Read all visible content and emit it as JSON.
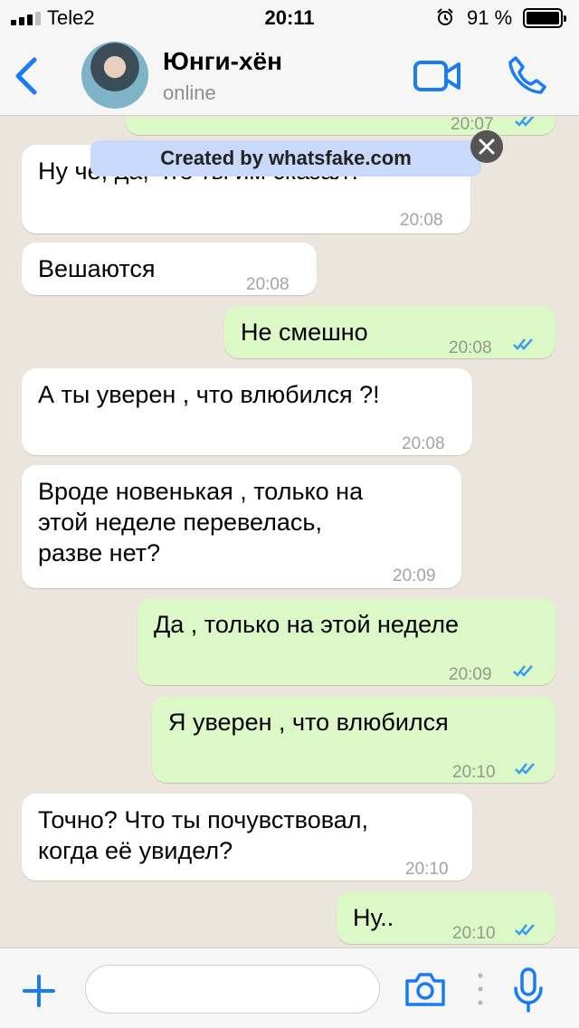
{
  "status_bar": {
    "carrier": "Tele2",
    "time": "20:11",
    "battery_percent": "91 %"
  },
  "header": {
    "contact_name": "Юнги-хён",
    "contact_status": "online"
  },
  "watermark": "Created by whatsfake.com",
  "messages": [
    {
      "direction": "out",
      "text": "",
      "time": "20:07",
      "read": true
    },
    {
      "direction": "in",
      "text": "Ну че, да, что ты им сказал?",
      "time": "20:08"
    },
    {
      "direction": "in",
      "text": "Вешаются",
      "time": "20:08"
    },
    {
      "direction": "out",
      "text": "Не смешно",
      "time": "20:08",
      "read": true
    },
    {
      "direction": "in",
      "text": "А ты уверен , что влюбился ?!",
      "time": "20:08"
    },
    {
      "direction": "in",
      "text": "Вроде новенькая , только на\nэтой неделе перевелась,\nразве нет?",
      "time": "20:09"
    },
    {
      "direction": "out",
      "text": "Да , только на этой неделе",
      "time": "20:09",
      "read": true
    },
    {
      "direction": "out",
      "text": "Я уверен , что влюбился",
      "time": "20:10",
      "read": true
    },
    {
      "direction": "in",
      "text": "Точно? Что ты почувствовал,\nкогда её увидел?",
      "time": "20:10"
    },
    {
      "direction": "out",
      "text": "Ну..",
      "time": "20:10",
      "read": true
    }
  ],
  "input": {
    "placeholder": ""
  },
  "colors": {
    "accent": "#1a7cf2",
    "outgoing_bubble": "#dcf8c6",
    "incoming_bubble": "#ffffff",
    "chat_background": "#ece5dd",
    "read_ticks": "#3b9cf0"
  },
  "icons": [
    "back-icon",
    "video-call-icon",
    "phone-icon",
    "close-icon",
    "plus-icon",
    "camera-icon",
    "microphone-icon",
    "read-ticks-icon",
    "alarm-icon"
  ]
}
